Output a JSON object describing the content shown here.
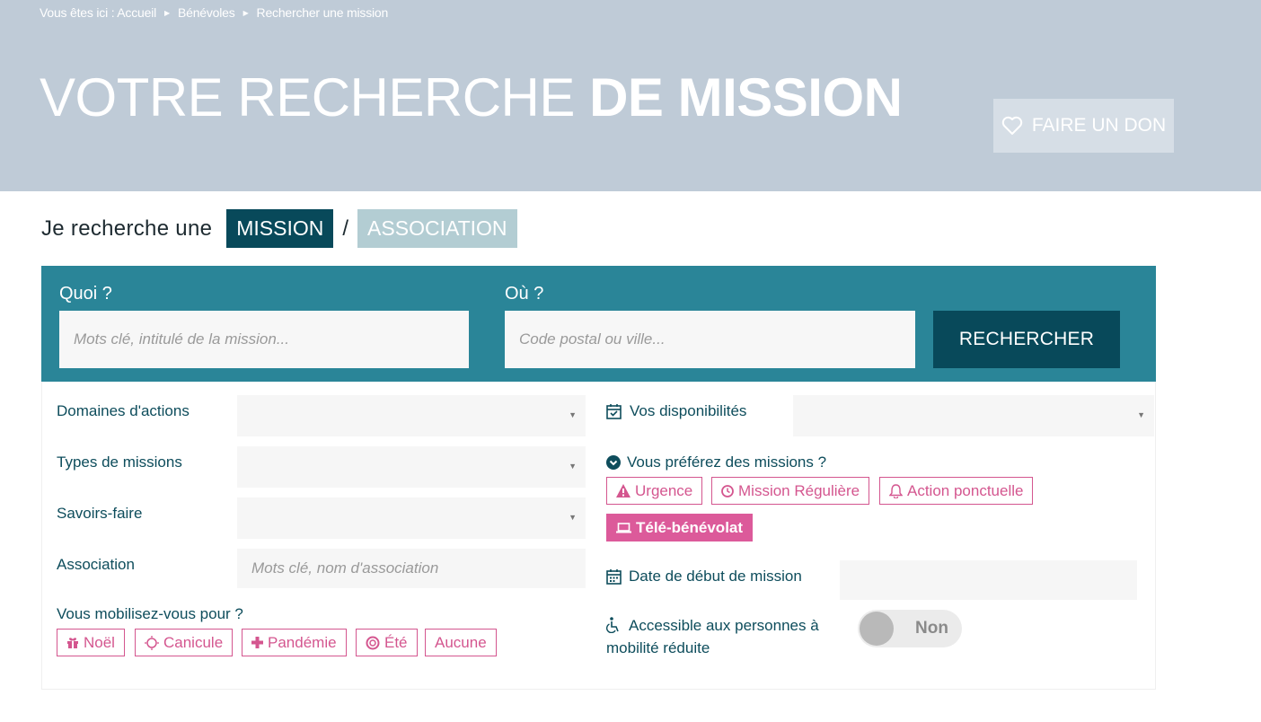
{
  "breadcrumb": {
    "prefix": "Vous êtes ici : Accueil",
    "items": [
      "Bénévoles",
      "Rechercher une mission"
    ]
  },
  "page_title": {
    "light": "VOTRE RECHERCHE",
    "bold": "DE MISSION"
  },
  "donate": {
    "label": "FAIRE UN DON",
    "icon": "heart-icon"
  },
  "search_type": {
    "lead": "Je recherche une",
    "tabs": [
      {
        "label": "MISSION",
        "active": true
      },
      {
        "label": "ASSOCIATION",
        "active": false
      }
    ],
    "separator": "/"
  },
  "search": {
    "what_label": "Quoi ?",
    "what_placeholder": "Mots clé, intitulé de la mission...",
    "where_label": "Où ?",
    "where_placeholder": "Code postal ou ville...",
    "button": "RECHERCHER"
  },
  "filters": {
    "domaines": {
      "label": "Domaines d'actions",
      "value": ""
    },
    "types": {
      "label": "Types de missions",
      "value": ""
    },
    "savoirs": {
      "label": "Savoirs-faire",
      "value": ""
    },
    "association": {
      "label": "Association",
      "placeholder": "Mots clé, nom d'association"
    },
    "mobilisation": {
      "label": "Vous mobilisez-vous pour ?",
      "chips": [
        {
          "label": "Noël",
          "icon": "gift-icon"
        },
        {
          "label": "Canicule",
          "icon": "sun-icon"
        },
        {
          "label": "Pandémie",
          "icon": "plus-icon"
        },
        {
          "label": "Été",
          "icon": "lifebuoy-icon"
        },
        {
          "label": "Aucune",
          "icon": ""
        }
      ]
    },
    "disponibilites": {
      "label": "Vos disponibilités",
      "icon": "calendar-check-icon",
      "value": ""
    },
    "preferences": {
      "label": "Vous préférez des missions ?",
      "icon": "chevron-circle-down-icon",
      "chips": [
        {
          "label": "Urgence",
          "icon": "warning-icon",
          "selected": false
        },
        {
          "label": "Mission Régulière",
          "icon": "clock-icon",
          "selected": false
        },
        {
          "label": "Action ponctuelle",
          "icon": "bell-icon",
          "selected": false
        },
        {
          "label": "Télé-bénévolat",
          "icon": "laptop-icon",
          "selected": true
        }
      ]
    },
    "date_debut": {
      "label": "Date de début de mission",
      "icon": "calendar-icon",
      "value": ""
    },
    "accessible": {
      "label_line1": "Accessible aux personnes à",
      "label_line2": "mobilité réduite",
      "icon": "wheelchair-icon",
      "toggle_value": "Non"
    }
  },
  "colors": {
    "banner": "#bfcbd7",
    "search_bar": "#2a8598",
    "dark_teal": "#08495a",
    "pink": "#d4568f"
  }
}
